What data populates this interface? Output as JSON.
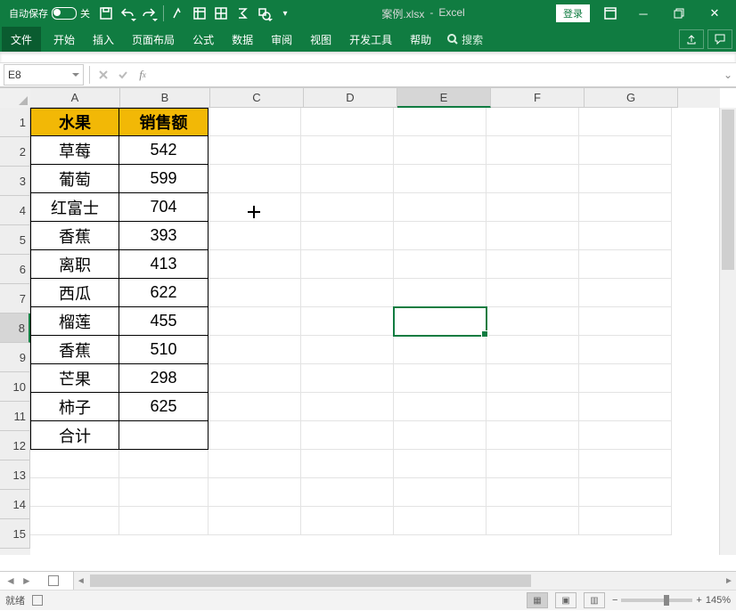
{
  "title": {
    "filename": "案例.xlsx",
    "appname": "Excel"
  },
  "autosave": {
    "label": "自动保存",
    "state_label": "关"
  },
  "login_button": "登录",
  "ribbon_tabs": {
    "file": "文件",
    "home": "开始",
    "insert": "插入",
    "layout": "页面布局",
    "formulas": "公式",
    "data": "数据",
    "review": "审阅",
    "view": "视图",
    "developer": "开发工具",
    "help": "帮助"
  },
  "search_placeholder": "搜索",
  "name_box_value": "E8",
  "formula_value": "",
  "columns": [
    "A",
    "B",
    "C",
    "D",
    "E",
    "F",
    "G"
  ],
  "selected_col": "E",
  "selected_row": 8,
  "row_count": 15,
  "table": {
    "header": {
      "A": "水果",
      "B": "销售额"
    },
    "rows": [
      {
        "A": "草莓",
        "B": "542"
      },
      {
        "A": "葡萄",
        "B": "599"
      },
      {
        "A": "红富士",
        "B": "704"
      },
      {
        "A": "香蕉",
        "B": "393"
      },
      {
        "A": "离职",
        "B": "413"
      },
      {
        "A": "西瓜",
        "B": "622"
      },
      {
        "A": "榴莲",
        "B": "455"
      },
      {
        "A": "香蕉",
        "B": "510"
      },
      {
        "A": "芒果",
        "B": "298"
      },
      {
        "A": "柿子",
        "B": "625"
      },
      {
        "A": "合计",
        "B": ""
      }
    ]
  },
  "status": {
    "ready": "就绪",
    "zoom": "145%"
  },
  "colors": {
    "accent": "#107c41",
    "header_fill": "#f2b806"
  }
}
